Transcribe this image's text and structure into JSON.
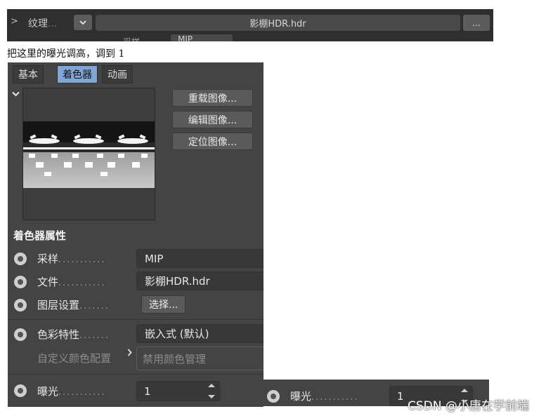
{
  "top_strip": {
    "texture_label": "纹理",
    "dots": "...",
    "file_name": "影棚HDR.hdr",
    "more_button": "...",
    "sample_label": "采样",
    "sample_value": "MIP"
  },
  "note": "把这里的曝光调高，调到 1",
  "tabs": [
    {
      "label": "基本",
      "active": false
    },
    {
      "label": "着色器",
      "active": true
    },
    {
      "label": "动画",
      "active": false
    }
  ],
  "preview_buttons": {
    "reload": "重载图像...",
    "edit": "编辑图像...",
    "locate": "定位图像..."
  },
  "section_title": "着色器属性",
  "attributes": {
    "sample": {
      "label": "采样",
      "dots": "...........",
      "value": "MIP"
    },
    "file": {
      "label": "文件",
      "dots": "...........",
      "value": "影棚HDR.hdr"
    },
    "layer": {
      "label": "图层设置",
      "dots": ".......",
      "button": "选择..."
    },
    "color": {
      "label": "色彩特性",
      "dots": ".......",
      "value": "嵌入式 (默认)"
    },
    "custom_profile": {
      "label": "自定义颜色配置",
      "value": "禁用颜色管理"
    },
    "exposure": {
      "label": "曝光",
      "dots": "...........",
      "value": "1"
    }
  },
  "exposure_duplicate": {
    "label": "曝光",
    "dots": "...........",
    "value": "1"
  },
  "watermark": "CSDN @小唐在学前端",
  "colors": {
    "panel_bg": "#444444",
    "tab_active": "#7fa6d4",
    "field_bg": "#383838"
  },
  "icons": [
    "chevron-right-icon",
    "chevron-down-icon",
    "radio-icon",
    "spinner-arrows-icon"
  ]
}
